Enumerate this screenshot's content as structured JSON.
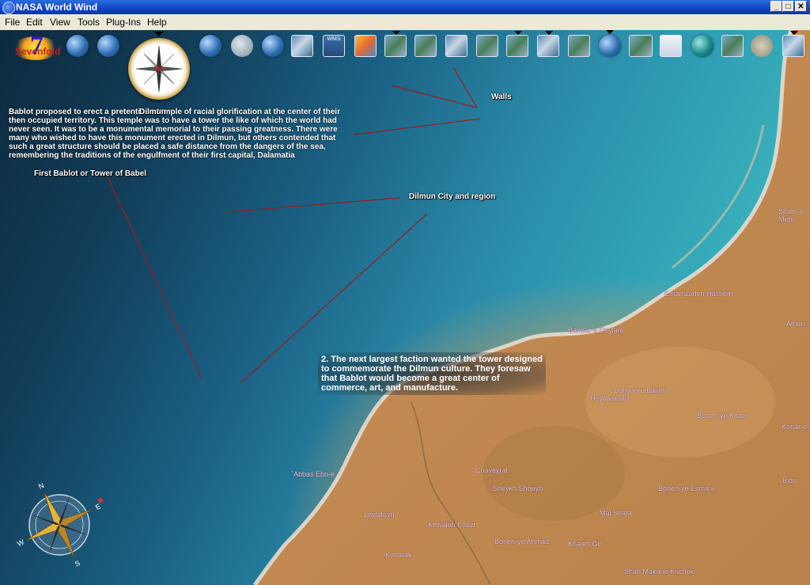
{
  "window": {
    "title": "NASA World Wind",
    "buttons": {
      "minimize": "_",
      "maximize": "□",
      "close": "✕"
    }
  },
  "menu": [
    "File",
    "Edit",
    "View",
    "Tools",
    "Plug-Ins",
    "Help"
  ],
  "toolbar": {
    "brand": {
      "number": "7",
      "word": "Sevenfold"
    },
    "wms_label": "WMS"
  },
  "annotations": {
    "overlap": "Dilmun",
    "walls": "Walls",
    "dilmun_city": "Dilmun City and region",
    "tower": "First Bablot or Tower of Babel",
    "paragraph": "Bablot proposed to erect a pretentious temple of racial glorification at the center of their then occupied territory. This temple was to have a tower the like of which the world had never seen. It was to be a monumental memorial to their passing greatness. There were many who wished to have this monument erected in Dilmun, but others contended that such a great structure should be placed a safe distance from the dangers of the sea, remembering the traditions of the engulfment of their first capital, Dalamatia",
    "faction": "2. The next largest faction wanted the tower designed to commemorate the Dilmun culture. They foresaw that Bablot would become a great center of commerce, art, and manufacture."
  },
  "places": [
    {
      "name": "Shahr-e Mehr",
      "key": "p1"
    },
    {
      "name": "Bandar-e Deylam",
      "key": "p2"
    },
    {
      "name": "Ameri",
      "key": "p3"
    },
    {
      "name": "Emamzadeh Hashem",
      "key": "p4"
    },
    {
      "name": "Dariya-ye Baladi",
      "key": "p5"
    },
    {
      "name": "Heydarabad",
      "key": "p6"
    },
    {
      "name": "Boneh-ye Khaer",
      "key": "p7"
    },
    {
      "name": "Konar-e",
      "key": "p8"
    },
    {
      "name": "`Abbas Ebn-e",
      "key": "p9"
    },
    {
      "name": "Chaveyrat",
      "key": "p10"
    },
    {
      "name": "Sheykh Shoeyb",
      "key": "p11"
    },
    {
      "name": "Boneh-ye Esma`il",
      "key": "p12"
    },
    {
      "name": "Bidu",
      "key": "p13"
    },
    {
      "name": "Mal Shafa",
      "key": "p14"
    },
    {
      "name": "Leylateyn",
      "key": "p15"
    },
    {
      "name": "Khwajeh Khezr",
      "key": "p16"
    },
    {
      "name": "Boneh-ye Ahmad",
      "key": "p17"
    },
    {
      "name": "Khajeh Gir",
      "key": "p18"
    },
    {
      "name": "Konarak",
      "key": "p19"
    },
    {
      "name": "Shah Makane Kucheki",
      "key": "p20"
    }
  ],
  "compass_rose": {
    "n": "N",
    "e": "E",
    "s": "S",
    "w": "W"
  }
}
